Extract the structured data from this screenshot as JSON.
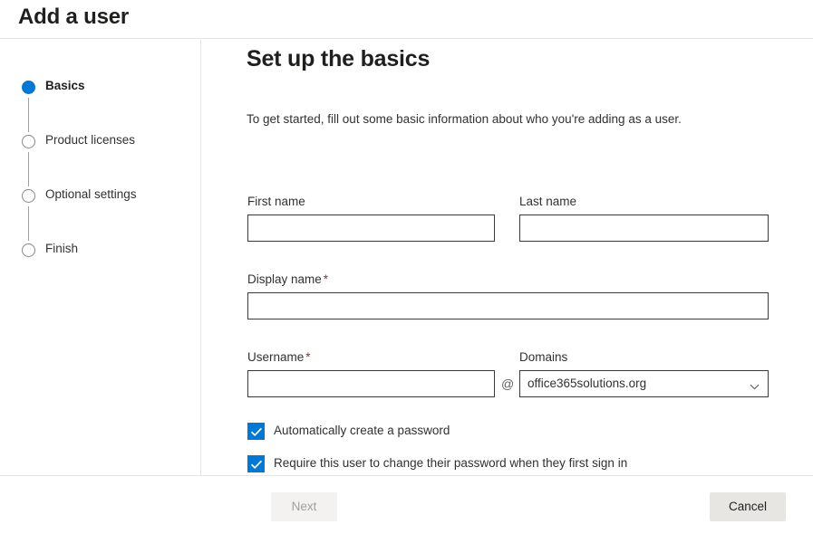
{
  "header": {
    "title": "Add a user"
  },
  "sidebar": {
    "steps": [
      {
        "label": "Basics",
        "state": "active"
      },
      {
        "label": "Product licenses",
        "state": "inactive"
      },
      {
        "label": "Optional settings",
        "state": "inactive"
      },
      {
        "label": "Finish",
        "state": "inactive"
      }
    ]
  },
  "main": {
    "title": "Set up the basics",
    "description": "To get started, fill out some basic information about who you're adding as a user.",
    "fields": {
      "first_name": {
        "label": "First name",
        "value": "",
        "required": false
      },
      "last_name": {
        "label": "Last name",
        "value": "",
        "required": false
      },
      "display_name": {
        "label": "Display name",
        "value": "",
        "required": true,
        "required_marker": "*"
      },
      "username": {
        "label": "Username",
        "value": "",
        "required": true,
        "required_marker": "*"
      },
      "domains": {
        "label": "Domains",
        "selected": "office365solutions.org",
        "separator": "@"
      }
    },
    "checkboxes": [
      {
        "label": "Automatically create a password",
        "checked": true
      },
      {
        "label": "Require this user to change their password when they first sign in",
        "checked": true
      }
    ]
  },
  "footer": {
    "next_label": "Next",
    "next_disabled": true,
    "cancel_label": "Cancel"
  },
  "colors": {
    "accent": "#0078d4",
    "required_star": "#a4262c",
    "text": "#323130",
    "border": "#3b3a39",
    "divider": "#e6e6e6",
    "disabled_text": "#a19f9d"
  }
}
